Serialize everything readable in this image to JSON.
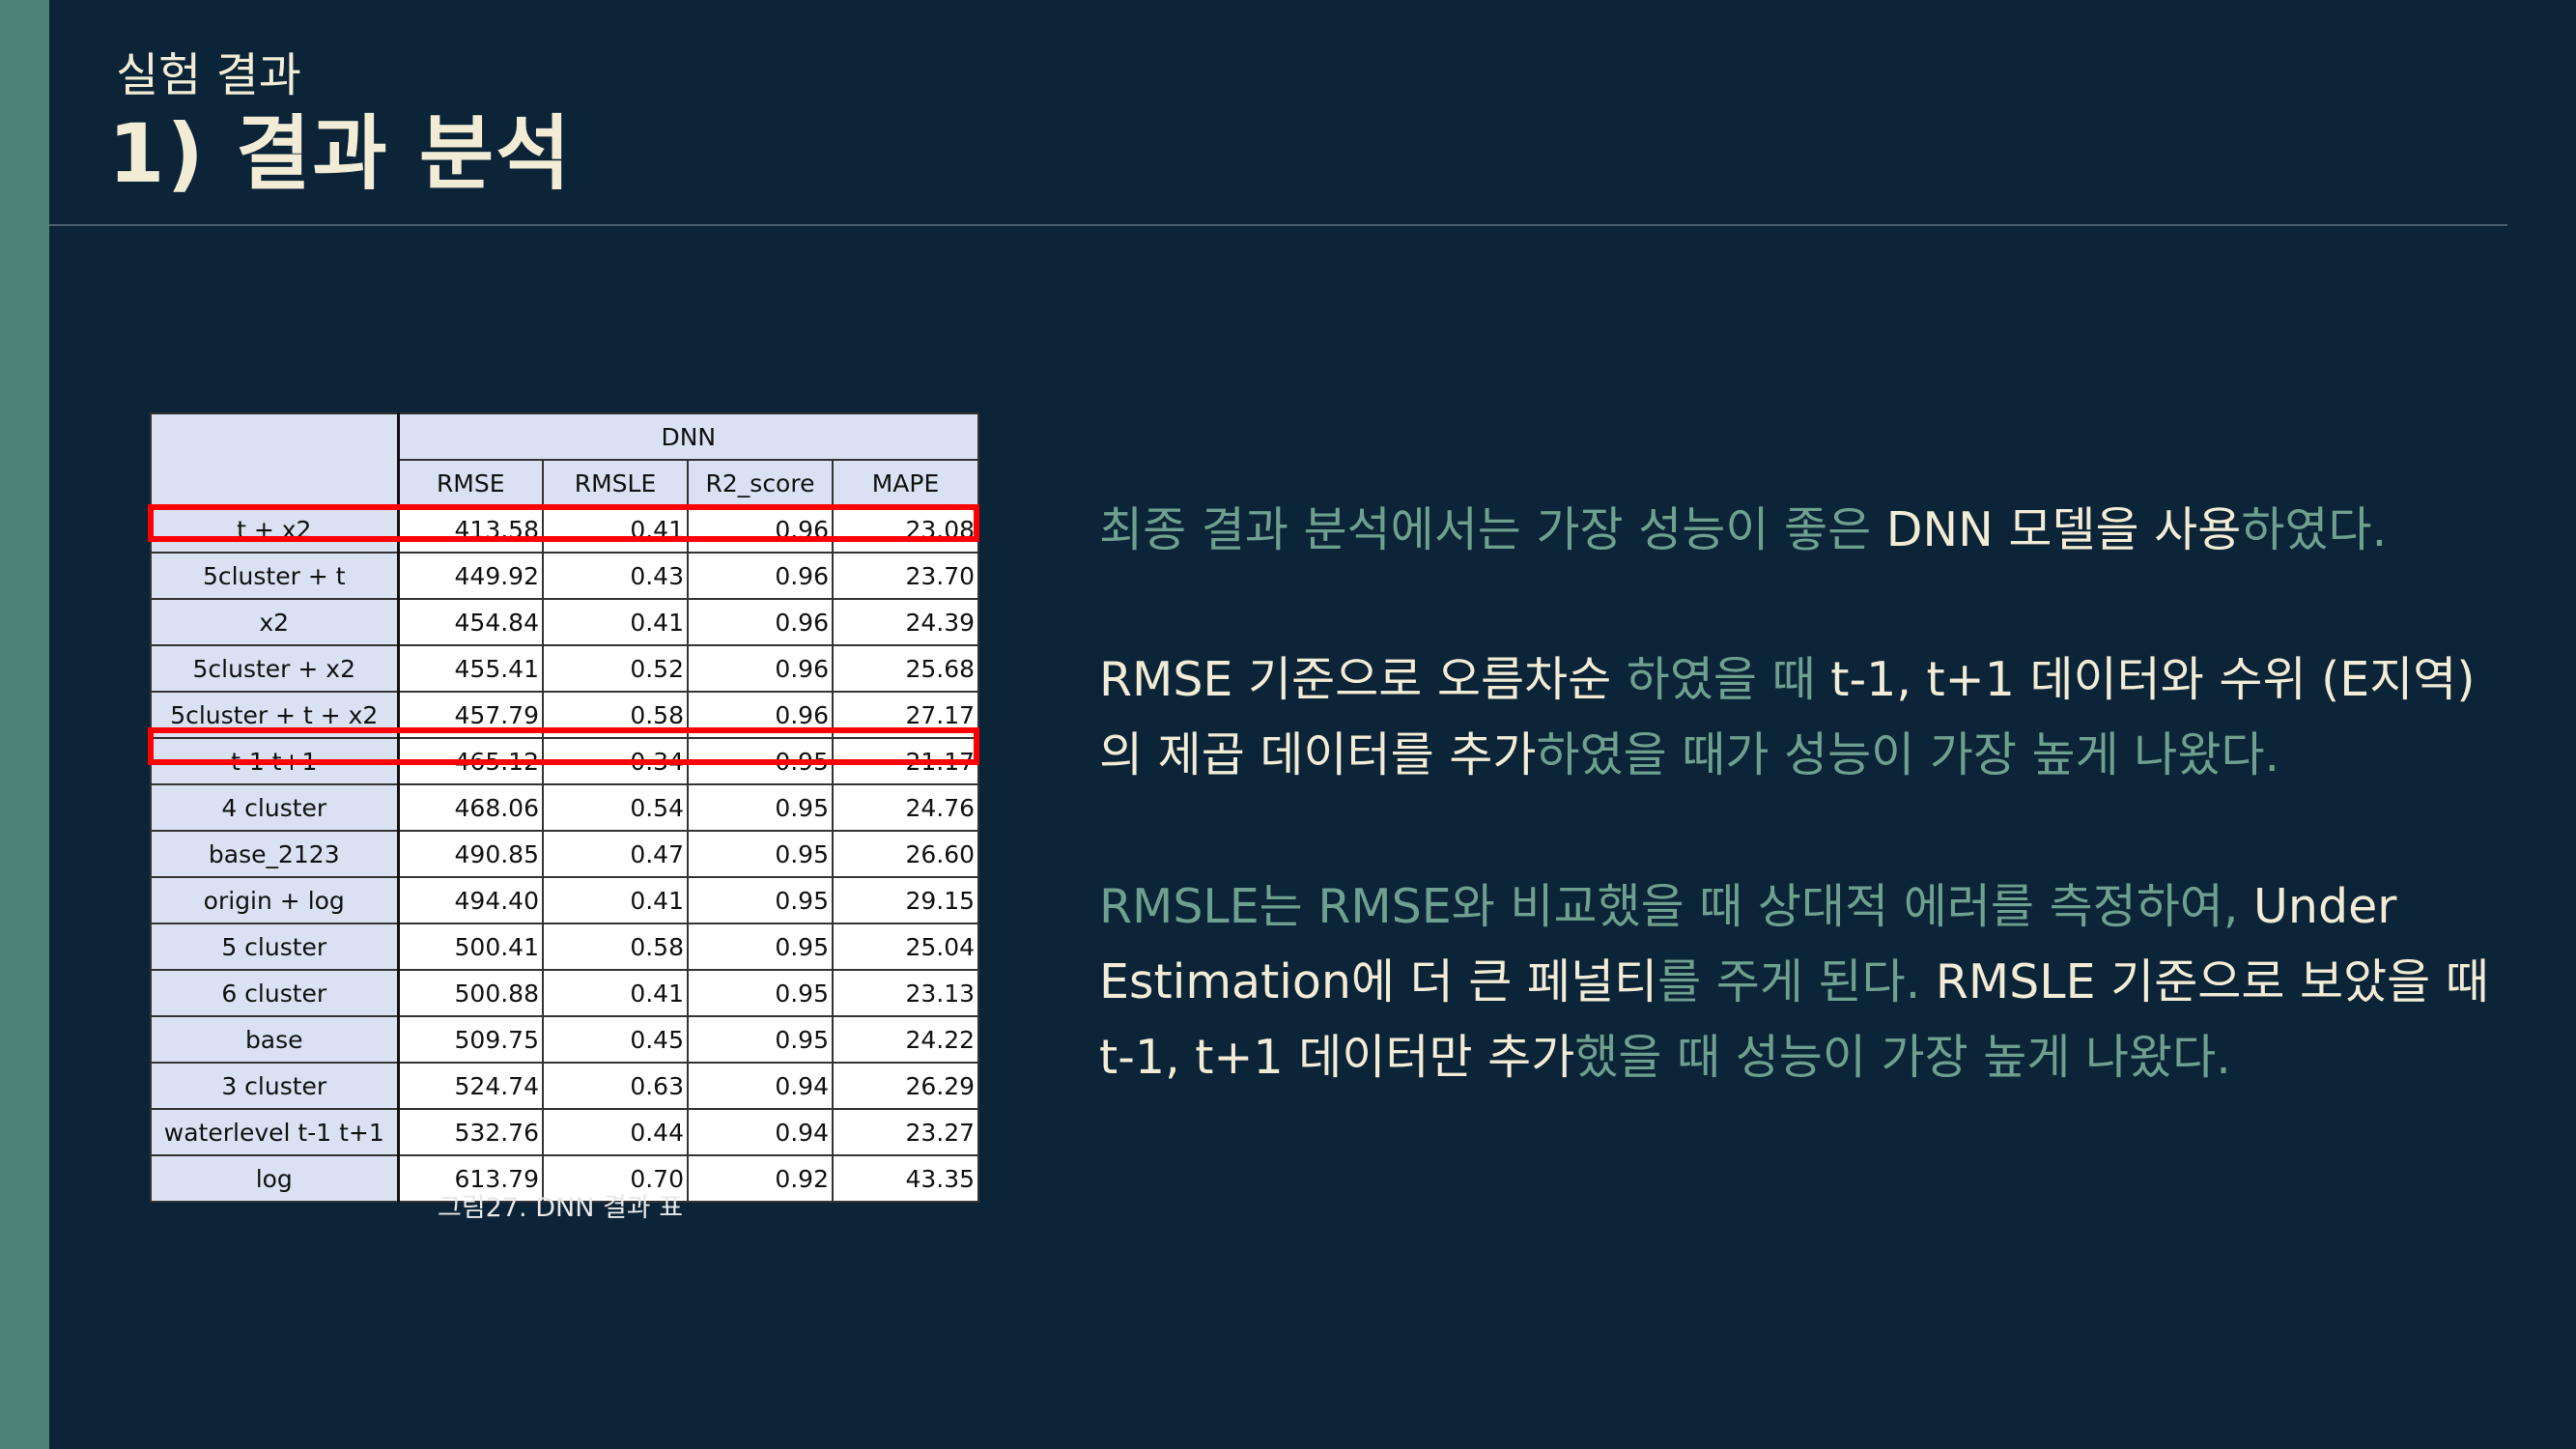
{
  "header": {
    "section_label": "실험 결과",
    "title": "1) 결과 분석"
  },
  "table": {
    "group_header": "DNN",
    "columns": [
      "RMSE",
      "RMSLE",
      "R2_score",
      "MAPE"
    ],
    "rows": [
      {
        "label": "t + x2",
        "values": [
          "413.58",
          "0.41",
          "0.96",
          "23.08"
        ],
        "highlighted": true
      },
      {
        "label": "5cluster + t",
        "values": [
          "449.92",
          "0.43",
          "0.96",
          "23.70"
        ]
      },
      {
        "label": "x2",
        "values": [
          "454.84",
          "0.41",
          "0.96",
          "24.39"
        ]
      },
      {
        "label": "5cluster + x2",
        "values": [
          "455.41",
          "0.52",
          "0.96",
          "25.68"
        ]
      },
      {
        "label": "5cluster + t + x2",
        "values": [
          "457.79",
          "0.58",
          "0.96",
          "27.17"
        ]
      },
      {
        "label": "t-1 t+1",
        "values": [
          "465.12",
          "0.34",
          "0.95",
          "21.17"
        ],
        "highlighted": true
      },
      {
        "label": "4 cluster",
        "values": [
          "468.06",
          "0.54",
          "0.95",
          "24.76"
        ]
      },
      {
        "label": "base_2123",
        "values": [
          "490.85",
          "0.47",
          "0.95",
          "26.60"
        ]
      },
      {
        "label": "origin + log",
        "values": [
          "494.40",
          "0.41",
          "0.95",
          "29.15"
        ]
      },
      {
        "label": "5 cluster",
        "values": [
          "500.41",
          "0.58",
          "0.95",
          "25.04"
        ]
      },
      {
        "label": "6 cluster",
        "values": [
          "500.88",
          "0.41",
          "0.95",
          "23.13"
        ]
      },
      {
        "label": "base",
        "values": [
          "509.75",
          "0.45",
          "0.95",
          "24.22"
        ]
      },
      {
        "label": "3 cluster",
        "values": [
          "524.74",
          "0.63",
          "0.94",
          "26.29"
        ]
      },
      {
        "label": "waterlevel t-1 t+1",
        "values": [
          "532.76",
          "0.44",
          "0.94",
          "23.27"
        ]
      },
      {
        "label": "log",
        "values": [
          "613.79",
          "0.70",
          "0.92",
          "43.35"
        ]
      }
    ],
    "caption": "그림27. DNN 결과 표"
  },
  "paragraphs": {
    "p1": {
      "l1a": "최종 결과 분석에서는 가장 성능이 좋은 ",
      "l1b": "DNN 모델을 사용",
      "l1c": "하였다."
    },
    "p2": {
      "l1a": "RMSE 기준으로 오름차순 ",
      "l1b": "하였을 때 ",
      "l1c": "t-1, t+1 데이터와 수위 (E지역)",
      "l2a": "의 제곱 데이터를 추가",
      "l2b": "하였을 때가 성능이 가장 높게 나왔다."
    },
    "p3": {
      "l1a": "RMSLE는 RMSE와 비교했을 때 상대적 에러를 측정하여, ",
      "l1b": "Under",
      "l2a": "Estimation에 더 큰 페널티",
      "l2b": "를 주게 된다. ",
      "l2c": "RMSLE 기준으로 보았을 때",
      "l3a": "t-1, t+1 데이터만 추가",
      "l3b": "했을 때 성능이 가장 높게 나왔다."
    }
  },
  "colors": {
    "background": "#0c2437",
    "side_bar": "#4e8478",
    "title_text": "#f2ecd6",
    "muted_text": "#6f9f8f",
    "table_header_fill": "#d9e1f2",
    "highlight_border": "#ff0000"
  }
}
